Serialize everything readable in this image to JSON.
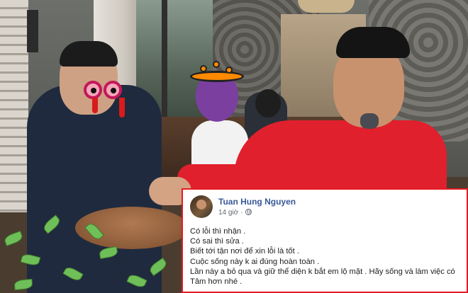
{
  "post": {
    "author": "Tuan Hung Nguyen",
    "time": "14 giờ",
    "separator": "·",
    "privacy_icon": "globe-icon",
    "lines": [
      "Có lỗi thì nhận .",
      "Có sai thì sửa .",
      "Biết tới tận nơi để xin lỗi là tốt .",
      "Cuộc sống này k ai đúng hoàn toàn .",
      "Lần này a bỏ qua và giữ thể diện k bắt em lộ mặt .  Hãy sống và làm việc có",
      "Tâm hơn nhé ."
    ]
  },
  "colors": {
    "highlight_border": "#e41b23",
    "author_link": "#385898",
    "red_hoodie": "#e0202c"
  },
  "photo": {
    "overlay_icons": [
      "crying-eyes-emoji",
      "cauldron-emoji"
    ]
  }
}
